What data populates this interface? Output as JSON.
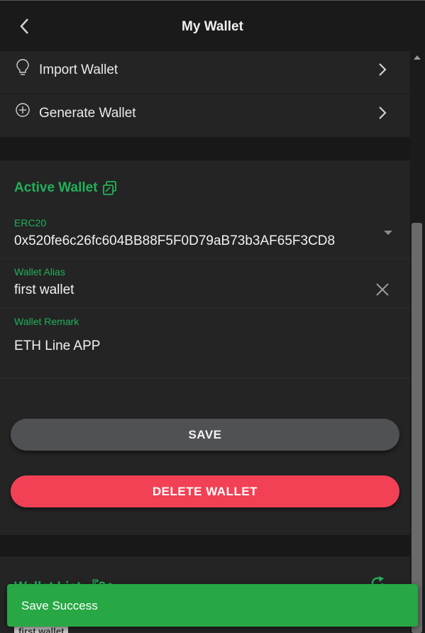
{
  "header": {
    "title": "My Wallet",
    "back_icon": "chevron-left-icon"
  },
  "menu": {
    "items": [
      {
        "label": "Import Wallet",
        "icon": "lightbulb-icon"
      },
      {
        "label": "Generate Wallet",
        "icon": "plus-circle-icon"
      }
    ]
  },
  "active_wallet": {
    "title": "Active Wallet",
    "copy_icon": "copy-icon",
    "network_label": "ERC20",
    "address": "0x520fe6c26fc604BB88F5F0D79aB73b3AF65F3CD8",
    "alias_label": "Wallet Alias",
    "alias_value": "first wallet",
    "remark_label": "Wallet Remark",
    "remark_value": "ETH Line APP"
  },
  "actions": {
    "save_label": "SAVE",
    "delete_label": "DELETE WALLET"
  },
  "wallet_list": {
    "title": "Wallet List 『2』",
    "chip": "first wallet"
  },
  "toast": {
    "message": "Save Success"
  },
  "colors": {
    "accent": "#22b05a",
    "danger": "#f24155",
    "toast": "#27a844"
  }
}
